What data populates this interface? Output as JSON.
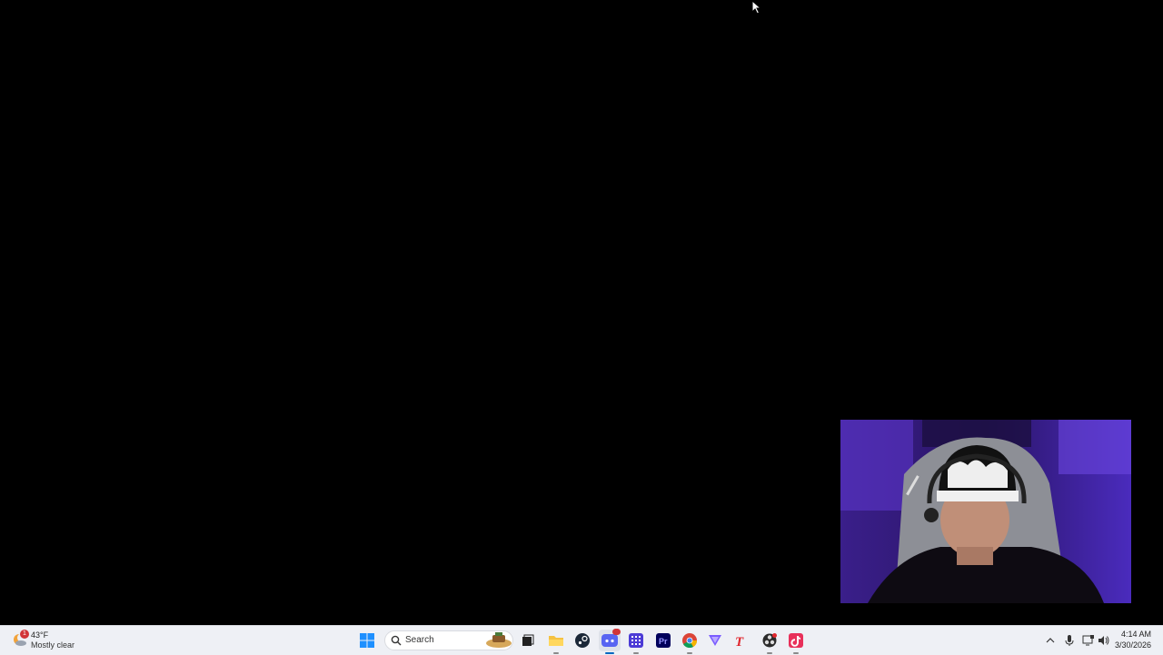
{
  "desktop": {
    "background": "#000000"
  },
  "webcam": {
    "description_label": ""
  },
  "taskbar": {
    "weather": {
      "badge": "1",
      "temperature": "43°F",
      "condition": "Mostly clear"
    },
    "search": {
      "placeholder": "Search"
    },
    "pinned": [
      {
        "name": "start-button",
        "icon": "windows-logo-icon"
      },
      {
        "name": "task-view",
        "icon": "task-view-icon"
      },
      {
        "name": "file-explorer",
        "icon": "folder-icon"
      },
      {
        "name": "steam",
        "icon": "steam-icon"
      },
      {
        "name": "discord",
        "icon": "discord-icon",
        "badge": "9+"
      },
      {
        "name": "app-grid",
        "icon": "grid-icon"
      },
      {
        "name": "premiere-pro",
        "icon": "premiere-icon",
        "label": "Pr"
      },
      {
        "name": "chrome",
        "icon": "chrome-icon"
      },
      {
        "name": "vpn",
        "icon": "triangle-icon"
      },
      {
        "name": "typing-app",
        "icon": "t-icon",
        "label": "T"
      },
      {
        "name": "obs",
        "icon": "obs-icon"
      },
      {
        "name": "tiktok",
        "icon": "tiktok-icon"
      }
    ],
    "clock": {
      "time": "4:14 AM",
      "date": "3/30/2026"
    }
  },
  "colors": {
    "taskbar_bg": "#eef0f5",
    "accent": "#0067c0",
    "webcam_purple": "#5b2bd6"
  }
}
